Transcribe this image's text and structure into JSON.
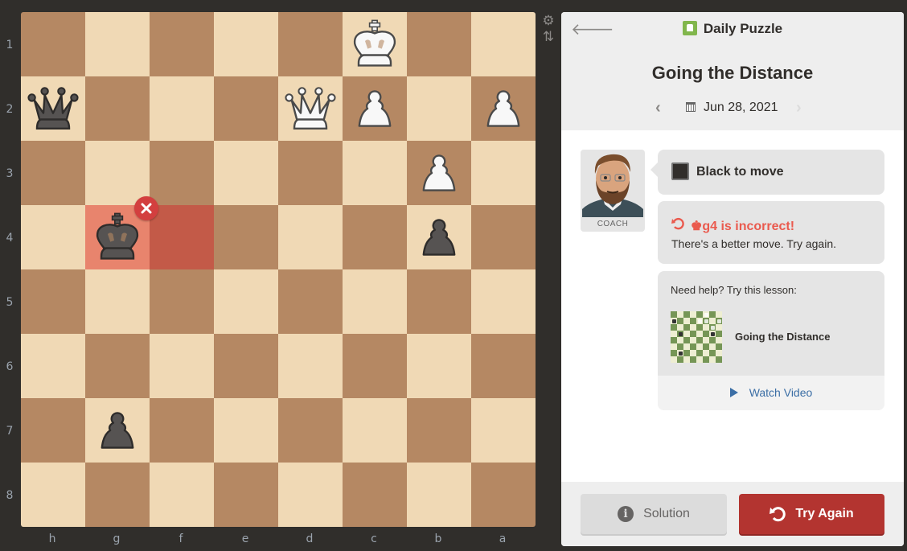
{
  "board": {
    "orientation": "black",
    "files": [
      "h",
      "g",
      "f",
      "e",
      "d",
      "c",
      "b",
      "a"
    ],
    "ranks": [
      "1",
      "2",
      "3",
      "4",
      "5",
      "6",
      "7",
      "8"
    ],
    "light_color": "#f0d9b5",
    "dark_color": "#b58863",
    "pieces": [
      {
        "square": "c1",
        "color": "white",
        "type": "king"
      },
      {
        "square": "h2",
        "color": "black",
        "type": "queen"
      },
      {
        "square": "d2",
        "color": "white",
        "type": "queen"
      },
      {
        "square": "c2",
        "color": "white",
        "type": "pawn"
      },
      {
        "square": "a2",
        "color": "white",
        "type": "pawn"
      },
      {
        "square": "b3",
        "color": "white",
        "type": "pawn"
      },
      {
        "square": "g4",
        "color": "black",
        "type": "king"
      },
      {
        "square": "b4",
        "color": "black",
        "type": "pawn"
      },
      {
        "square": "g7",
        "color": "black",
        "type": "pawn"
      }
    ],
    "highlights": {
      "from": "f4",
      "to": "g4",
      "from_color": "#c35a48",
      "to_color": "#e8846d"
    },
    "incorrect_marker_square": "g4"
  },
  "side_tools": {
    "settings_icon": "gear-icon",
    "flip_icon": "flip-board-icon"
  },
  "panel": {
    "header": {
      "back_icon": "arrow-left-icon",
      "title": "Daily Puzzle",
      "puzzle_name": "Going the Distance",
      "date": "Jun 28, 2021"
    },
    "coach": {
      "label": "COACH"
    },
    "to_move": "Black to move",
    "feedback": {
      "title": "♚g4 is incorrect!",
      "message": "There's a better move. Try again.",
      "color": "#ea5a4e"
    },
    "lesson": {
      "prompt": "Need help? Try this lesson:",
      "title": "Going the Distance",
      "watch_label": "Watch Video"
    },
    "footer": {
      "solution_label": "Solution",
      "try_again_label": "Try Again",
      "try_again_color": "#b33430"
    }
  }
}
